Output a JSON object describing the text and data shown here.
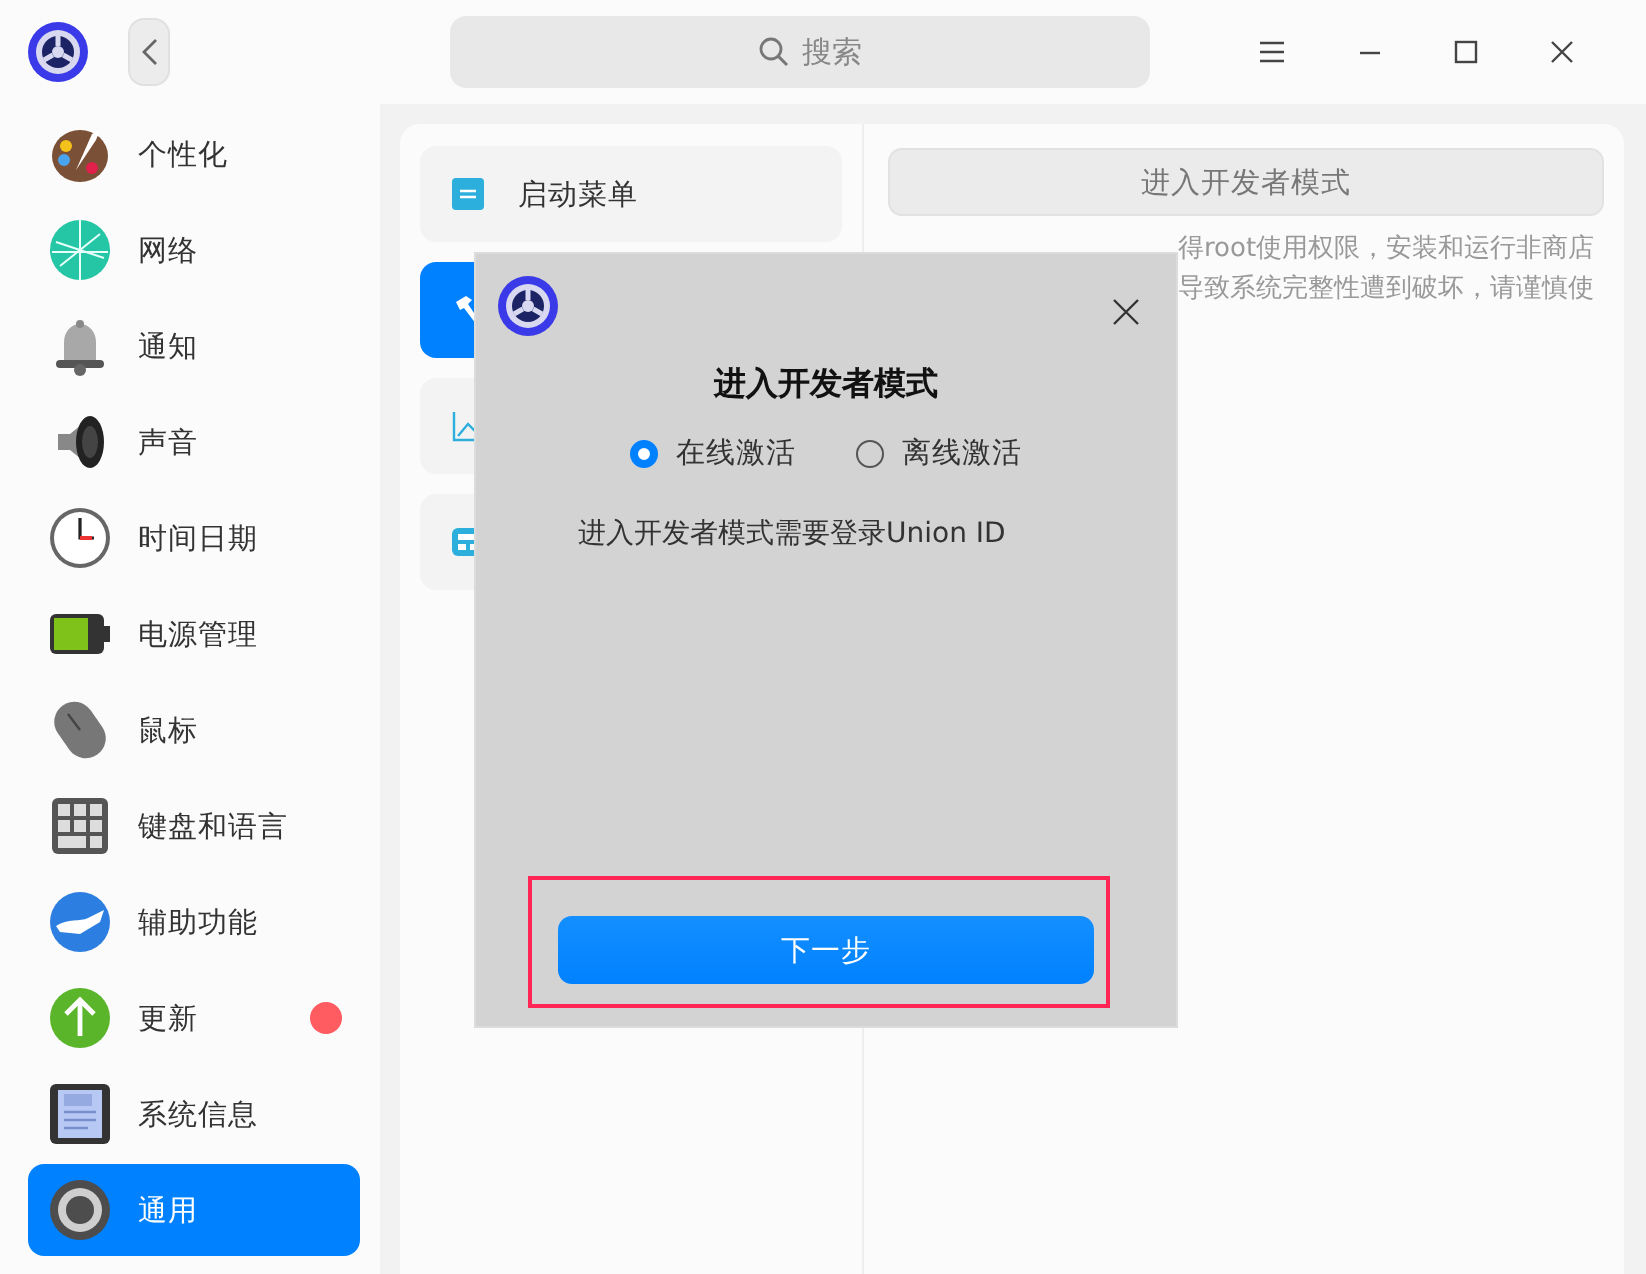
{
  "titlebar": {
    "search": {
      "placeholder": "搜索"
    }
  },
  "sidebar": {
    "items": [
      {
        "label": "个性化",
        "selected": false,
        "badge": false
      },
      {
        "label": "网络",
        "selected": false,
        "badge": false
      },
      {
        "label": "通知",
        "selected": false,
        "badge": false
      },
      {
        "label": "声音",
        "selected": false,
        "badge": false
      },
      {
        "label": "时间日期",
        "selected": false,
        "badge": false
      },
      {
        "label": "电源管理",
        "selected": false,
        "badge": false
      },
      {
        "label": "鼠标",
        "selected": false,
        "badge": false
      },
      {
        "label": "键盘和语言",
        "selected": false,
        "badge": false
      },
      {
        "label": "辅助功能",
        "selected": false,
        "badge": false
      },
      {
        "label": "更新",
        "selected": false,
        "badge": true
      },
      {
        "label": "系统信息",
        "selected": false,
        "badge": false
      },
      {
        "label": "通用",
        "selected": true,
        "badge": false
      }
    ]
  },
  "submenu": {
    "items": [
      {
        "label": "启动菜单",
        "selected": false
      },
      {
        "selected": true
      },
      {
        "selected": false
      },
      {
        "selected": false
      }
    ]
  },
  "detail": {
    "button": "进入开发者模式",
    "description": [
      "得root使用权限，安装和运行非商店",
      "导致系统完整性遭到破坏，请谨慎使"
    ]
  },
  "dialog": {
    "title": "进入开发者模式",
    "options": [
      {
        "label": "在线激活",
        "selected": true
      },
      {
        "label": "离线激活",
        "selected": false
      }
    ],
    "message": "进入开发者模式需要登录Union ID",
    "button": "下一步",
    "highlighted": true
  }
}
